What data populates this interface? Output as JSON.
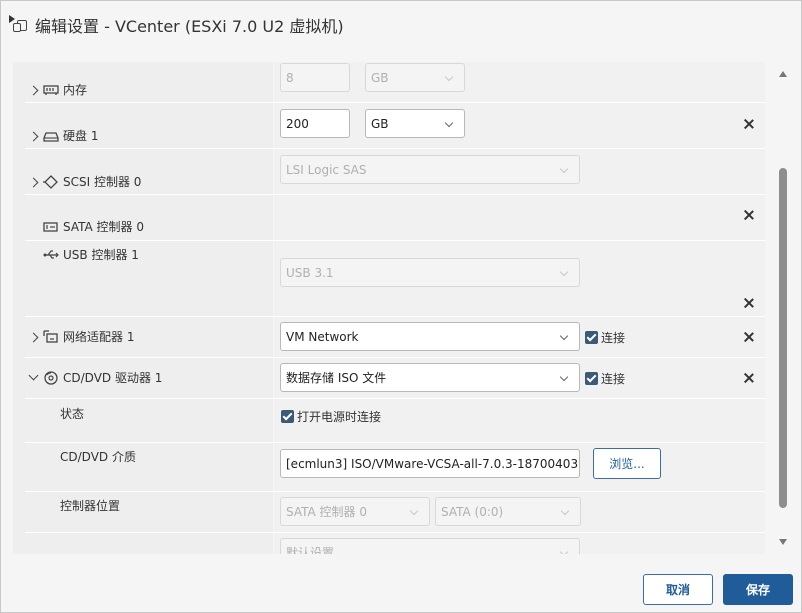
{
  "dialog": {
    "title": "编辑设置 - VCenter (ESXi 7.0 U2 虚拟机)"
  },
  "rows": {
    "memory": {
      "label": "内存",
      "value": "8",
      "unit": "GB"
    },
    "hard_disk": {
      "label": "硬盘 1",
      "value": "200",
      "unit": "GB"
    },
    "scsi": {
      "label": "SCSI 控制器 0",
      "type": "LSI Logic SAS"
    },
    "sata": {
      "label": "SATA 控制器 0"
    },
    "usb": {
      "label": "USB 控制器 1",
      "type": "USB 3.1"
    },
    "network": {
      "label": "网络适配器 1",
      "value": "VM Network",
      "connect_label": "连接",
      "connected": true
    },
    "cddvd": {
      "label": "CD/DVD 驱动器 1",
      "value": "数据存储 ISO 文件",
      "connect_label": "连接",
      "connected": true,
      "status_label": "状态",
      "power_on_connect": "打开电源时连接",
      "media_label": "CD/DVD 介质",
      "media_path": "[ecmlun3] ISO/VMware-VCSA-all-7.0.3-18700403",
      "browse_label": "浏览...",
      "controller_location_label": "控制器位置",
      "controller_value": "SATA 控制器 0",
      "controller_slot": "SATA (0:0)",
      "default_setting": "默认设置"
    }
  },
  "footer": {
    "cancel_label": "取消",
    "save_label": "保存"
  },
  "colors": {
    "primary": "#1f5c99",
    "checkbox": "#3a5a75"
  }
}
